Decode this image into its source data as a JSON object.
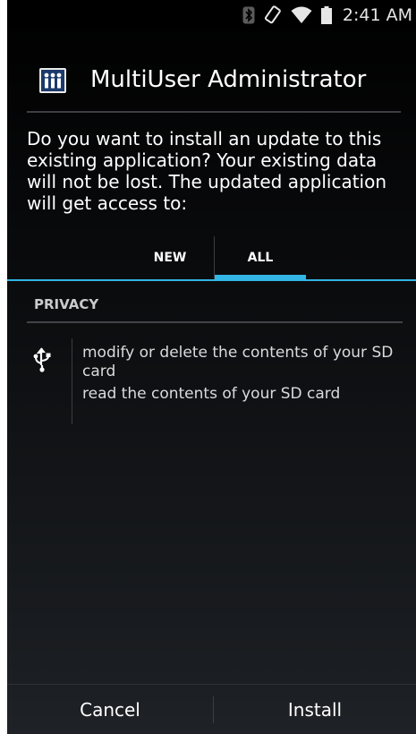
{
  "status_bar": {
    "time": "2:41 AM",
    "icons": [
      "bluetooth-icon",
      "screen-rotation-icon",
      "wifi-icon",
      "battery-icon"
    ]
  },
  "dialog": {
    "app_title": "MultiUser Administrator",
    "app_icon": "multiuser-app-icon",
    "message": "Do you want to install an update to this existing application? Your existing data will not be lost. The updated application will get access to:"
  },
  "tabs": [
    {
      "label": "NEW",
      "selected": false
    },
    {
      "label": "ALL",
      "selected": true
    }
  ],
  "permissions": {
    "section_title": "PRIVACY",
    "icon": "usb-storage-icon",
    "items": [
      "modify or delete the contents of your SD card",
      "read the contents of your SD card"
    ]
  },
  "buttons": {
    "cancel": "Cancel",
    "install": "Install"
  },
  "colors": {
    "accent": "#33b5e5",
    "background": "#000000",
    "text": "#ffffff"
  }
}
